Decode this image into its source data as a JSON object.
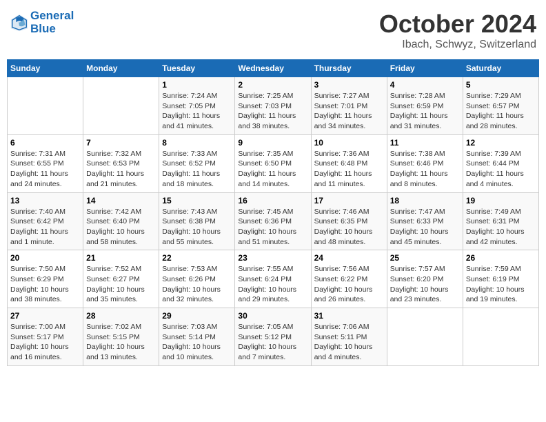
{
  "header": {
    "logo_line1": "General",
    "logo_line2": "Blue",
    "month": "October 2024",
    "location": "Ibach, Schwyz, Switzerland"
  },
  "weekdays": [
    "Sunday",
    "Monday",
    "Tuesday",
    "Wednesday",
    "Thursday",
    "Friday",
    "Saturday"
  ],
  "weeks": [
    [
      {
        "day": "",
        "info": ""
      },
      {
        "day": "",
        "info": ""
      },
      {
        "day": "1",
        "info": "Sunrise: 7:24 AM\nSunset: 7:05 PM\nDaylight: 11 hours and 41 minutes."
      },
      {
        "day": "2",
        "info": "Sunrise: 7:25 AM\nSunset: 7:03 PM\nDaylight: 11 hours and 38 minutes."
      },
      {
        "day": "3",
        "info": "Sunrise: 7:27 AM\nSunset: 7:01 PM\nDaylight: 11 hours and 34 minutes."
      },
      {
        "day": "4",
        "info": "Sunrise: 7:28 AM\nSunset: 6:59 PM\nDaylight: 11 hours and 31 minutes."
      },
      {
        "day": "5",
        "info": "Sunrise: 7:29 AM\nSunset: 6:57 PM\nDaylight: 11 hours and 28 minutes."
      }
    ],
    [
      {
        "day": "6",
        "info": "Sunrise: 7:31 AM\nSunset: 6:55 PM\nDaylight: 11 hours and 24 minutes."
      },
      {
        "day": "7",
        "info": "Sunrise: 7:32 AM\nSunset: 6:53 PM\nDaylight: 11 hours and 21 minutes."
      },
      {
        "day": "8",
        "info": "Sunrise: 7:33 AM\nSunset: 6:52 PM\nDaylight: 11 hours and 18 minutes."
      },
      {
        "day": "9",
        "info": "Sunrise: 7:35 AM\nSunset: 6:50 PM\nDaylight: 11 hours and 14 minutes."
      },
      {
        "day": "10",
        "info": "Sunrise: 7:36 AM\nSunset: 6:48 PM\nDaylight: 11 hours and 11 minutes."
      },
      {
        "day": "11",
        "info": "Sunrise: 7:38 AM\nSunset: 6:46 PM\nDaylight: 11 hours and 8 minutes."
      },
      {
        "day": "12",
        "info": "Sunrise: 7:39 AM\nSunset: 6:44 PM\nDaylight: 11 hours and 4 minutes."
      }
    ],
    [
      {
        "day": "13",
        "info": "Sunrise: 7:40 AM\nSunset: 6:42 PM\nDaylight: 11 hours and 1 minute."
      },
      {
        "day": "14",
        "info": "Sunrise: 7:42 AM\nSunset: 6:40 PM\nDaylight: 10 hours and 58 minutes."
      },
      {
        "day": "15",
        "info": "Sunrise: 7:43 AM\nSunset: 6:38 PM\nDaylight: 10 hours and 55 minutes."
      },
      {
        "day": "16",
        "info": "Sunrise: 7:45 AM\nSunset: 6:36 PM\nDaylight: 10 hours and 51 minutes."
      },
      {
        "day": "17",
        "info": "Sunrise: 7:46 AM\nSunset: 6:35 PM\nDaylight: 10 hours and 48 minutes."
      },
      {
        "day": "18",
        "info": "Sunrise: 7:47 AM\nSunset: 6:33 PM\nDaylight: 10 hours and 45 minutes."
      },
      {
        "day": "19",
        "info": "Sunrise: 7:49 AM\nSunset: 6:31 PM\nDaylight: 10 hours and 42 minutes."
      }
    ],
    [
      {
        "day": "20",
        "info": "Sunrise: 7:50 AM\nSunset: 6:29 PM\nDaylight: 10 hours and 38 minutes."
      },
      {
        "day": "21",
        "info": "Sunrise: 7:52 AM\nSunset: 6:27 PM\nDaylight: 10 hours and 35 minutes."
      },
      {
        "day": "22",
        "info": "Sunrise: 7:53 AM\nSunset: 6:26 PM\nDaylight: 10 hours and 32 minutes."
      },
      {
        "day": "23",
        "info": "Sunrise: 7:55 AM\nSunset: 6:24 PM\nDaylight: 10 hours and 29 minutes."
      },
      {
        "day": "24",
        "info": "Sunrise: 7:56 AM\nSunset: 6:22 PM\nDaylight: 10 hours and 26 minutes."
      },
      {
        "day": "25",
        "info": "Sunrise: 7:57 AM\nSunset: 6:20 PM\nDaylight: 10 hours and 23 minutes."
      },
      {
        "day": "26",
        "info": "Sunrise: 7:59 AM\nSunset: 6:19 PM\nDaylight: 10 hours and 19 minutes."
      }
    ],
    [
      {
        "day": "27",
        "info": "Sunrise: 7:00 AM\nSunset: 5:17 PM\nDaylight: 10 hours and 16 minutes."
      },
      {
        "day": "28",
        "info": "Sunrise: 7:02 AM\nSunset: 5:15 PM\nDaylight: 10 hours and 13 minutes."
      },
      {
        "day": "29",
        "info": "Sunrise: 7:03 AM\nSunset: 5:14 PM\nDaylight: 10 hours and 10 minutes."
      },
      {
        "day": "30",
        "info": "Sunrise: 7:05 AM\nSunset: 5:12 PM\nDaylight: 10 hours and 7 minutes."
      },
      {
        "day": "31",
        "info": "Sunrise: 7:06 AM\nSunset: 5:11 PM\nDaylight: 10 hours and 4 minutes."
      },
      {
        "day": "",
        "info": ""
      },
      {
        "day": "",
        "info": ""
      }
    ]
  ]
}
